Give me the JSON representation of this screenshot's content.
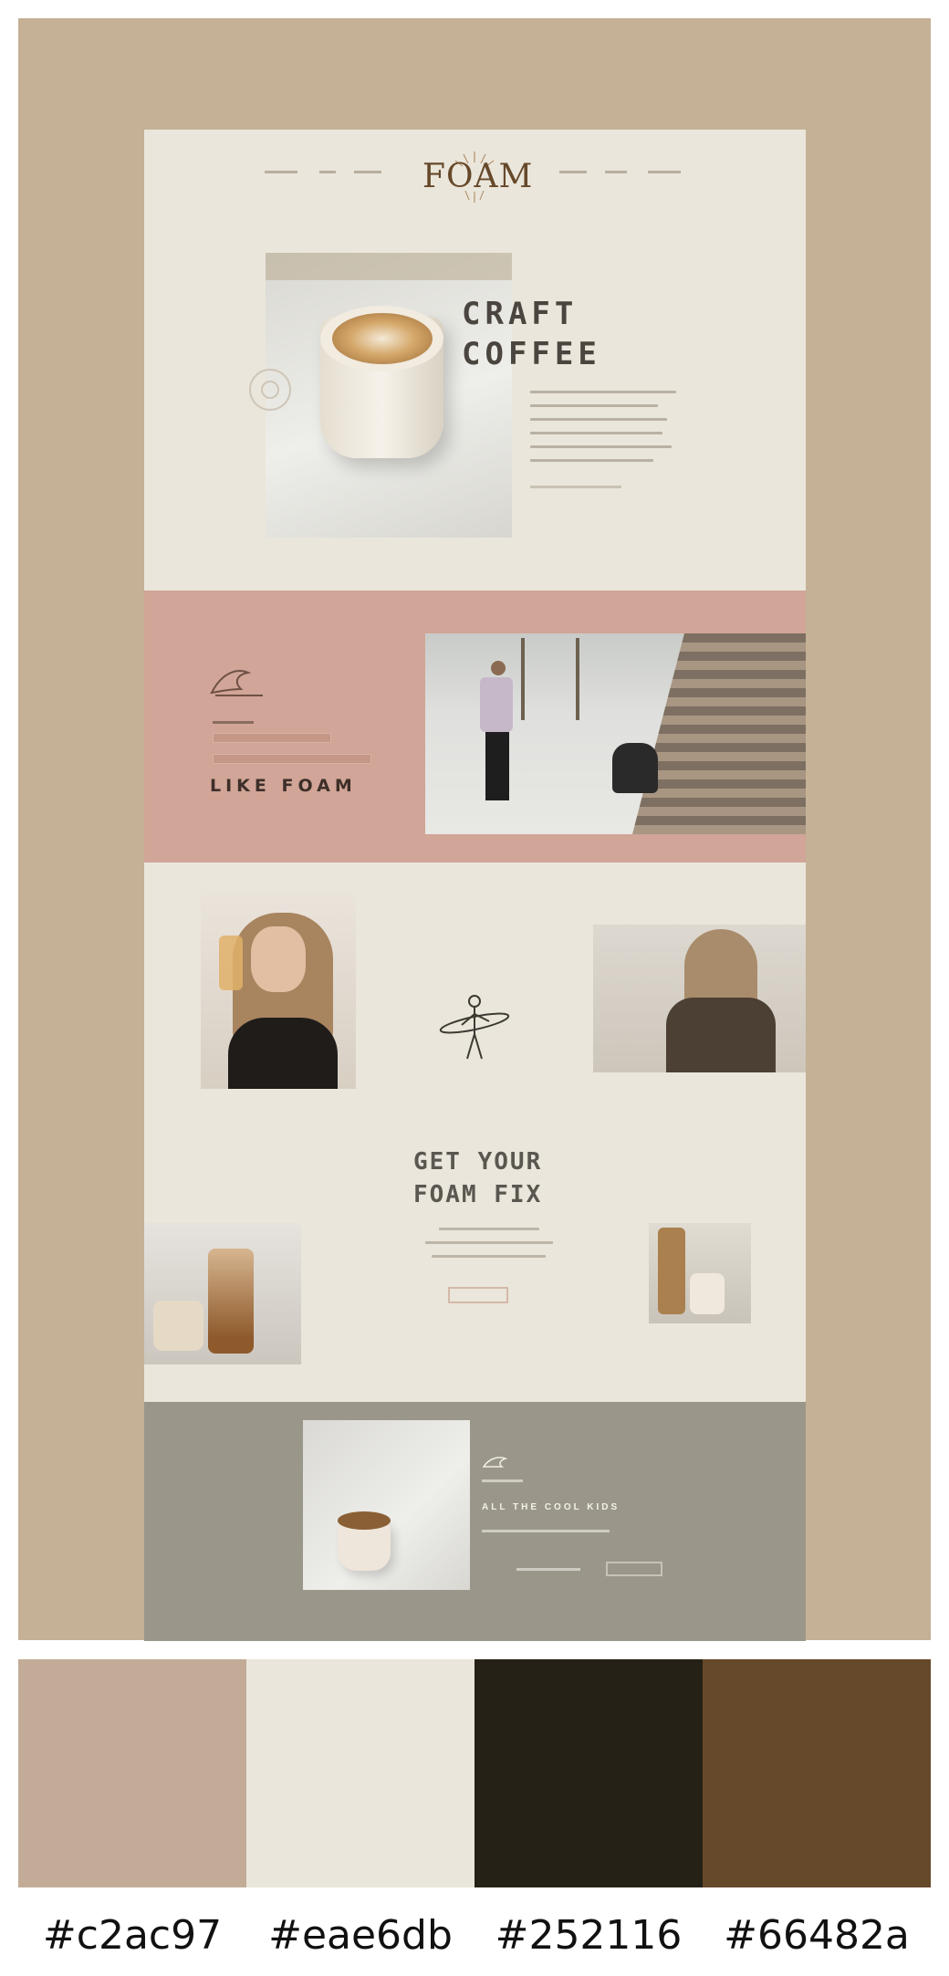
{
  "hero": {
    "title": "CRAFT\nCOFFEE"
  },
  "brand": {
    "logo": "FOAM"
  },
  "band": {
    "title": "LIKE FOAM"
  },
  "feature": {
    "title": "GET YOUR\nFOAM FIX"
  },
  "footer": {
    "title": "ALL THE COOL KIDS"
  },
  "palette": [
    {
      "color": "#c2ac97",
      "label": "#c2ac97"
    },
    {
      "color": "#eae6db",
      "label": "#eae6db"
    },
    {
      "color": "#252116",
      "label": "#252116"
    },
    {
      "color": "#66482a",
      "label": "#66482a"
    }
  ]
}
